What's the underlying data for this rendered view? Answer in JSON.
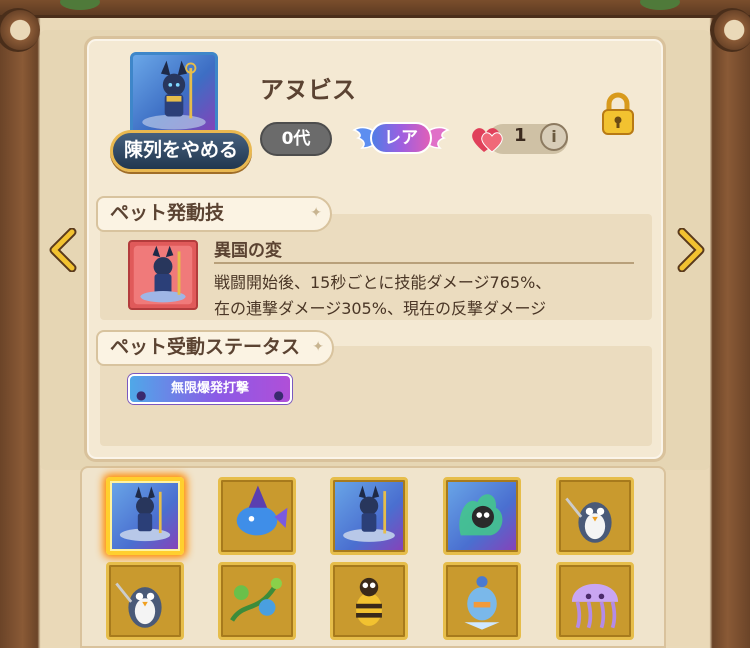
{
  "pet": {
    "name": "アヌビス",
    "unequip_label": "陳列をやめる",
    "generation": "0代",
    "rarity": "レア",
    "hearts": "1",
    "info_glyph": "i"
  },
  "active_skill": {
    "section_title": "ペット発動技",
    "name": "異国の変",
    "description_lines": [
      "戦闘開始後、15秒ごとに技能ダメージ765%、",
      "在の連撃ダメージ305%、現在の反撃ダメージ"
    ]
  },
  "passive": {
    "section_title": "ペット受動ステータス",
    "chips": [
      "無限爆発打撃"
    ]
  },
  "pet_grid": {
    "slots": [
      {
        "name": "anubis",
        "selected": true,
        "style": "blue"
      },
      {
        "name": "blue-fish-wizard",
        "selected": false,
        "style": "gold"
      },
      {
        "name": "anubis",
        "selected": false,
        "style": "blue"
      },
      {
        "name": "green-spirit-cat",
        "selected": false,
        "style": "blue"
      },
      {
        "name": "penguin-warrior",
        "selected": false,
        "style": "gold"
      },
      {
        "name": "penguin-warrior",
        "selected": false,
        "style": "gold"
      },
      {
        "name": "flower-vine",
        "selected": false,
        "style": "gold"
      },
      {
        "name": "bee-robot",
        "selected": false,
        "style": "gold"
      },
      {
        "name": "ice-bird",
        "selected": false,
        "style": "gold"
      },
      {
        "name": "jellyfish",
        "selected": false,
        "style": "gold"
      }
    ]
  },
  "colors": {
    "wood": "#6b4428",
    "parchment": "#f4e9d3",
    "accent_gold": "#e6bd4a",
    "text": "#5b4332"
  }
}
